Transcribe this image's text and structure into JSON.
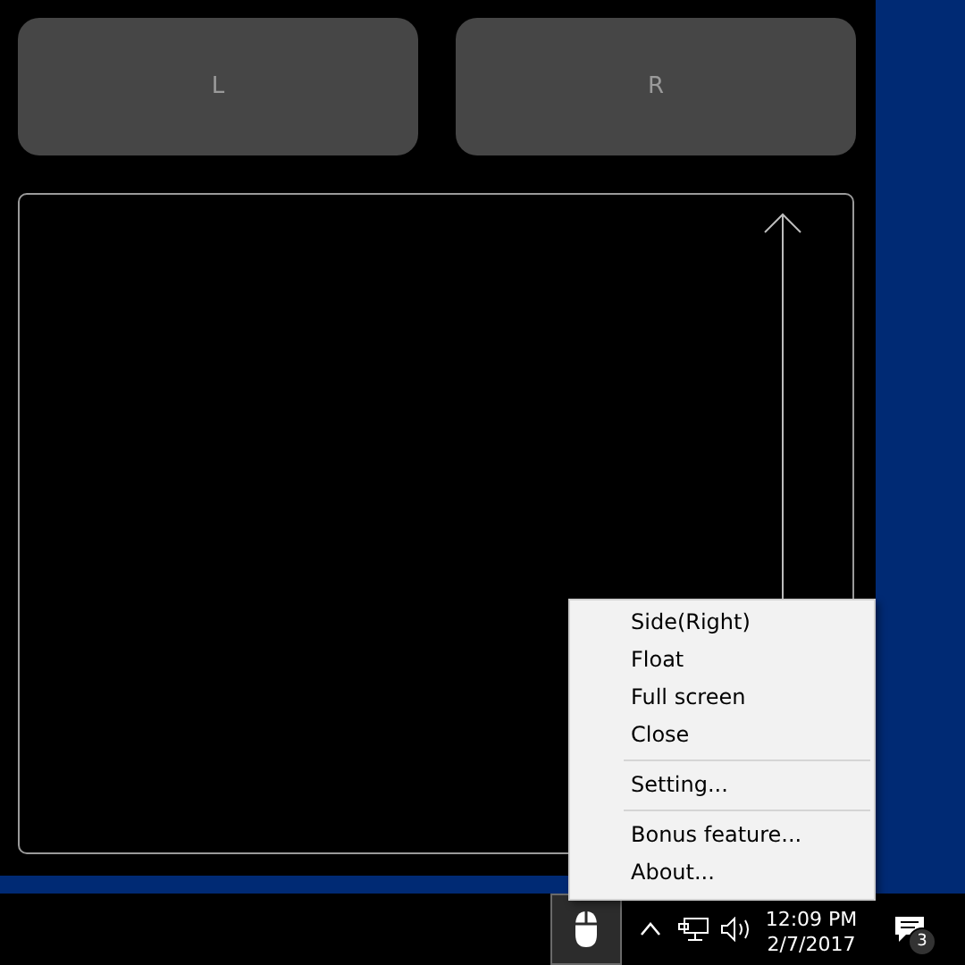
{
  "buttons": [
    {
      "label": "L"
    },
    {
      "label": "R"
    }
  ],
  "context_menu": {
    "items": [
      {
        "kind": "item",
        "label": "Side(Right)"
      },
      {
        "kind": "item",
        "label": "Float"
      },
      {
        "kind": "item",
        "label": "Full screen"
      },
      {
        "kind": "item",
        "label": "Close"
      },
      {
        "kind": "separator"
      },
      {
        "kind": "item",
        "label": "Setting..."
      },
      {
        "kind": "separator"
      },
      {
        "kind": "item",
        "label": "Bonus feature..."
      },
      {
        "kind": "item",
        "label": "About..."
      }
    ]
  },
  "taskbar": {
    "time": "12:09 PM",
    "date": "2/7/2017",
    "notification_count": "3"
  }
}
